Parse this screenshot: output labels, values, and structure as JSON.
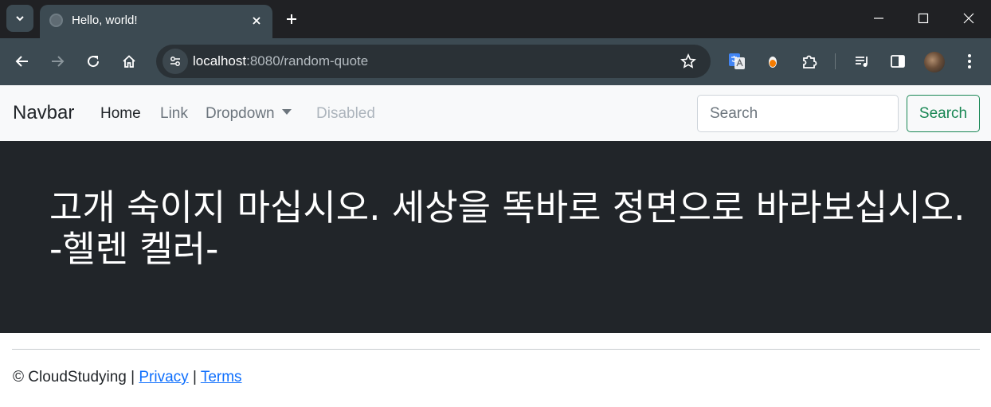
{
  "browser": {
    "tab_title": "Hello, world!",
    "url_host": "localhost",
    "url_rest": ":8080/random-quote"
  },
  "navbar": {
    "brand": "Navbar",
    "links": {
      "home": "Home",
      "link": "Link",
      "dropdown": "Dropdown",
      "disabled": "Disabled"
    },
    "search": {
      "placeholder": "Search",
      "button_label": "Search"
    }
  },
  "hero": {
    "quote": "고개 숙이지 마십시오. 세상을 똑바로 정면으로 바라보십시오. -헬렌 켈러-"
  },
  "footer": {
    "copyright_symbol": "©",
    "owner": "CloudStudying",
    "separator": "|",
    "privacy": "Privacy",
    "terms": "Terms"
  },
  "colors": {
    "hero_background": "#212529",
    "navbar_background": "#f8f9fa",
    "search_button_accent": "#198754",
    "link_color": "#0d6efd"
  }
}
